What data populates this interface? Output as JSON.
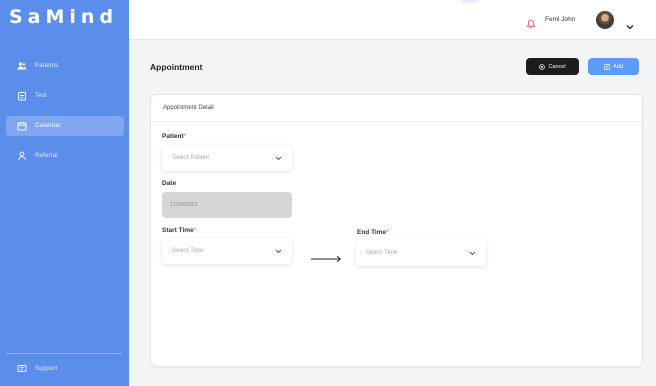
{
  "app": {
    "logo": "SaMind"
  },
  "sidebar": {
    "items": [
      {
        "label": "Patients",
        "icon": "users-icon",
        "active": false
      },
      {
        "label": "Test",
        "icon": "clipboard-icon",
        "active": false
      },
      {
        "label": "Calendar",
        "icon": "calendar-icon",
        "active": true
      },
      {
        "label": "Referral",
        "icon": "person-icon",
        "active": false
      }
    ],
    "support_label": "Support"
  },
  "topbar": {
    "username": "Femi John"
  },
  "page": {
    "title": "Appointment",
    "cancel_label": "Cancel",
    "add_label": "Add"
  },
  "form": {
    "card_title": "Appointment Detail",
    "patient": {
      "label": "Patient",
      "placeholder": "Select Patient"
    },
    "date": {
      "label": "Date",
      "value": "12/09/2023"
    },
    "start_time": {
      "label": "Start Time",
      "placeholder": "Select Time"
    },
    "end_time": {
      "label": "End Time",
      "placeholder": "Select Time"
    }
  },
  "colors": {
    "sidebar": "#5b8dea",
    "cancel_button": "#1c1c1e",
    "add_button": "#5b9cf5",
    "required": "#e55353"
  }
}
